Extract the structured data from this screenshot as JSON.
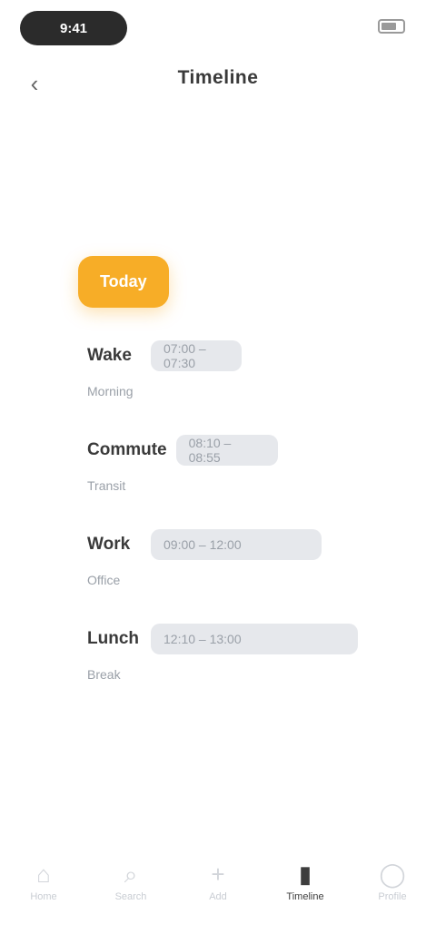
{
  "status_bar": {
    "time": "9:41",
    "battery_icon": "battery-icon"
  },
  "header": {
    "back_icon": "chevron-left-icon",
    "title": "Timeline"
  },
  "timeline": {
    "active_label": "Today",
    "items": [
      {
        "name": "Wake",
        "bar": "07:00 – 07:30",
        "sub": "Morning"
      },
      {
        "name": "Commute",
        "bar": "08:10 – 08:55",
        "sub": "Transit"
      },
      {
        "name": "Work",
        "bar": "09:00 – 12:00",
        "sub": "Office"
      },
      {
        "name": "Lunch",
        "bar": "12:10 – 13:00",
        "sub": "Break"
      }
    ]
  },
  "bottom_nav": {
    "items": [
      {
        "label": "Home",
        "icon": "home-icon",
        "glyph": "⌂"
      },
      {
        "label": "Search",
        "icon": "search-icon",
        "glyph": "⌕"
      },
      {
        "label": "Add",
        "icon": "plus-icon",
        "glyph": "+"
      },
      {
        "label": "Timeline",
        "icon": "timeline-icon",
        "glyph": "▮"
      },
      {
        "label": "Profile",
        "icon": "user-icon",
        "glyph": "◯"
      }
    ]
  }
}
